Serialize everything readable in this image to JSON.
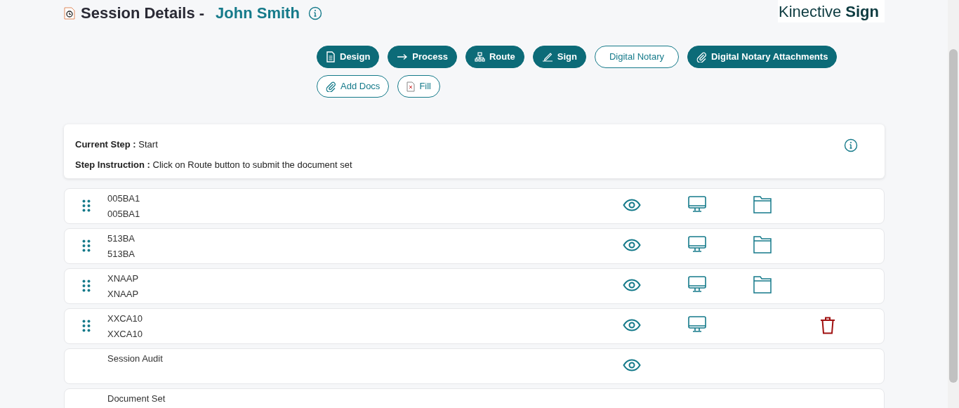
{
  "header": {
    "title": "Session Details -",
    "name": "John Smith"
  },
  "logo": {
    "light": "Kinective",
    "bold": "Sign"
  },
  "actions": [
    {
      "label": "Design",
      "kind": "design"
    },
    {
      "label": "Process",
      "kind": "process"
    },
    {
      "label": "Route",
      "kind": "route"
    },
    {
      "label": "Sign",
      "kind": "sign"
    },
    {
      "label": "Digital Notary",
      "kind": "notary"
    },
    {
      "label": "Digital Notary Attachments",
      "kind": "attachments"
    },
    {
      "label": "Add Docs",
      "kind": "adddocs"
    },
    {
      "label": "Fill",
      "kind": "fill"
    }
  ],
  "step_info": {
    "current_step_label": "Current Step :",
    "current_step": "Start",
    "instruction_label": "Step Instruction :",
    "instruction": "Click on Route button to submit the document set"
  },
  "documents": [
    {
      "title": "005BA1",
      "subtitle": "005BA1",
      "draggable": true,
      "view": true,
      "desktop": true,
      "folder": true,
      "delete": false
    },
    {
      "title": "513BA",
      "subtitle": "513BA",
      "draggable": true,
      "view": true,
      "desktop": true,
      "folder": true,
      "delete": false
    },
    {
      "title": "XNAAP",
      "subtitle": "XNAAP",
      "draggable": true,
      "view": true,
      "desktop": true,
      "folder": true,
      "delete": false
    },
    {
      "title": "XXCA10",
      "subtitle": "XXCA10",
      "draggable": true,
      "view": true,
      "desktop": true,
      "folder": false,
      "delete": true
    },
    {
      "title": "Session Audit",
      "draggable": false,
      "view": true,
      "desktop": false,
      "folder": false,
      "delete": false
    },
    {
      "title": "Document Set",
      "draggable": false,
      "view": false,
      "desktop": false,
      "folder": false,
      "delete": false
    }
  ]
}
